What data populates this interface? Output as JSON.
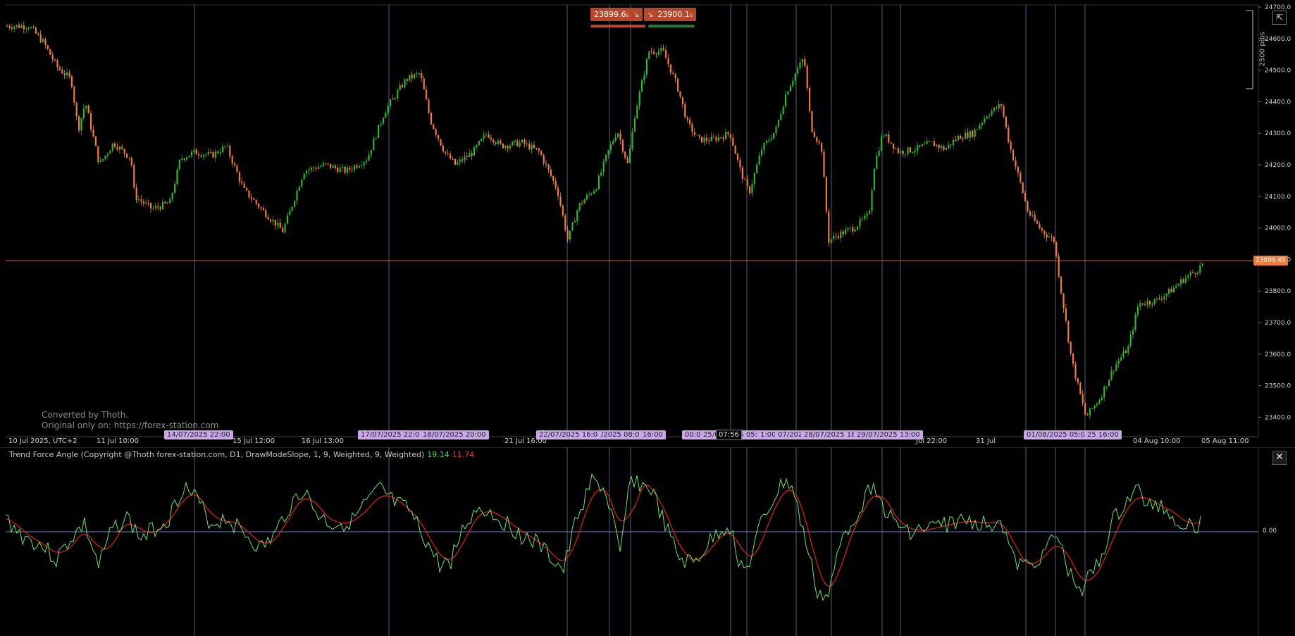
{
  "chart": {
    "buy_tag": "23899.6₅",
    "sell_tag": "23900.1₅",
    "tag_arrow": "↘",
    "pips_label": "2500 pips",
    "current_price": "23899.65",
    "cursor_time": "07:56",
    "watermark_line1": "Converted by Thoth.",
    "watermark_line2": "Original only on: https://forex-station.com",
    "price_axis": [
      "24700.0",
      "24600.0",
      "24500.0",
      "24400.0",
      "24300.0",
      "24200.0",
      "24100.0",
      "24000.0",
      "23900.0",
      "23800.0",
      "23700.0",
      "23600.0",
      "23500.0",
      "23400.0"
    ],
    "time_labels": [
      "10 Jul 2025, UTC+2",
      "11 Jul 10:00",
      "15 Jul 12:00",
      "16 Jul 13:00",
      "21 Jul 16:00",
      "Jul 22:00",
      "31 Jul",
      "04 Aug 10:00",
      "05 Aug 11:00"
    ],
    "time_tags": [
      "14/07/2025 22:00",
      "17/07/2025 22:00",
      "18/07/2025 20:00",
      "22/07/2025 16:00",
      "/2025 08:00",
      "16:00",
      "00:00",
      "25/07/2025 05:00",
      "1:00",
      "07/202",
      "28/07/2025 18:",
      "29/07/2025 13:00",
      "01/08/2025 05:00",
      "25 16:00"
    ],
    "colors": {
      "bull": "#2fb52f",
      "bear": "#f07b3f",
      "price_line": "#e0503a",
      "vlines": "#9a9ad8",
      "tag": "#b5472d",
      "time_tag": "#c8a8e6"
    }
  },
  "indicator": {
    "title": "Trend Force Angle (Copyright @Thoth forex-station.com, D1, DrawModeSlope, 1, 9, Weighted, 9, Weighted)",
    "value_fast": "19.14",
    "value_slow": "11.74",
    "zero_label": "0.00",
    "close_label": "✕",
    "colors": {
      "fast": "#6fe36f",
      "slow": "#e02020",
      "zero": "#6a7fd0"
    }
  },
  "toolbar": {
    "detach_icon": "⇱"
  }
}
